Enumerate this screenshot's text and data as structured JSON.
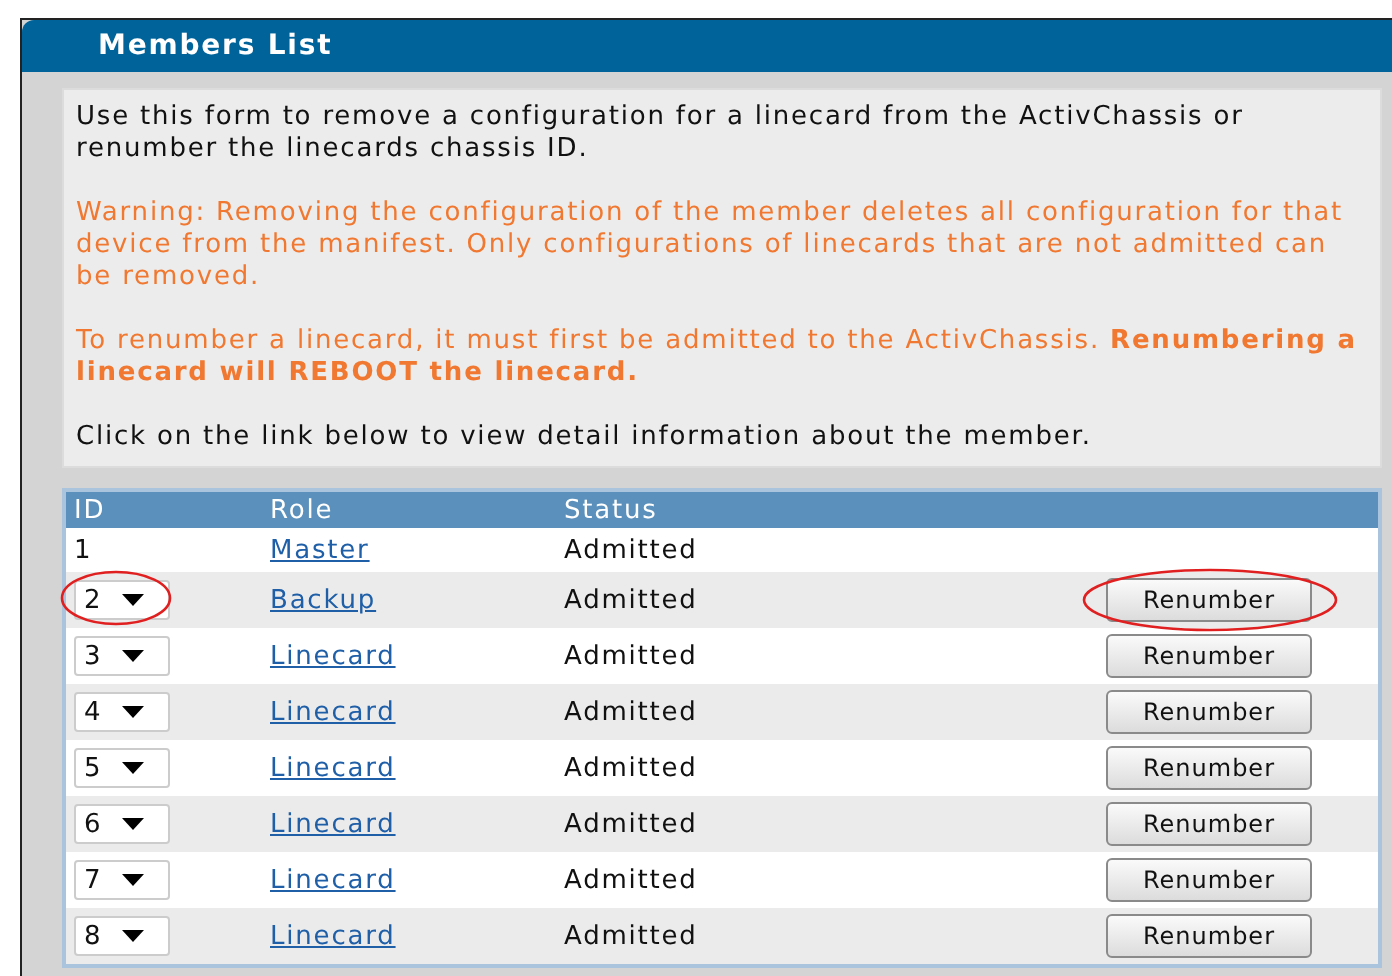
{
  "panel": {
    "title": "Members List"
  },
  "intro": "Use this form to remove a configuration for a linecard from the ActivChassis or renumber the linecards chassis ID.",
  "warnings": [
    "Warning: Removing the configuration of the member deletes all configuration for that device from the manifest. Only configurations of linecards that are not admitted can be removed.",
    "To renumber a linecard, it must first be admitted to the ActivChassis. **Renumbering a linecard will REBOOT the linecard.**"
  ],
  "hint": "Click on the link below to view detail information about the member.",
  "table": {
    "columns": [
      "ID",
      "Role",
      "Status"
    ],
    "rows": [
      {
        "kind": "fixed",
        "id": "1",
        "role": "Master",
        "status": "Admitted",
        "annotated": false
      },
      {
        "kind": "select",
        "id": "2",
        "role": "Backup",
        "status": "Admitted",
        "action": "Renumber",
        "annotated": true
      },
      {
        "kind": "select",
        "id": "3",
        "role": "Linecard",
        "status": "Admitted",
        "action": "Renumber",
        "annotated": false
      },
      {
        "kind": "select",
        "id": "4",
        "role": "Linecard",
        "status": "Admitted",
        "action": "Renumber",
        "annotated": false
      },
      {
        "kind": "select",
        "id": "5",
        "role": "Linecard",
        "status": "Admitted",
        "action": "Renumber",
        "annotated": false
      },
      {
        "kind": "select",
        "id": "6",
        "role": "Linecard",
        "status": "Admitted",
        "action": "Renumber",
        "annotated": false
      },
      {
        "kind": "select",
        "id": "7",
        "role": "Linecard",
        "status": "Admitted",
        "action": "Renumber",
        "annotated": false
      },
      {
        "kind": "select",
        "id": "8",
        "role": "Linecard",
        "status": "Admitted",
        "action": "Renumber",
        "annotated": false
      }
    ]
  }
}
